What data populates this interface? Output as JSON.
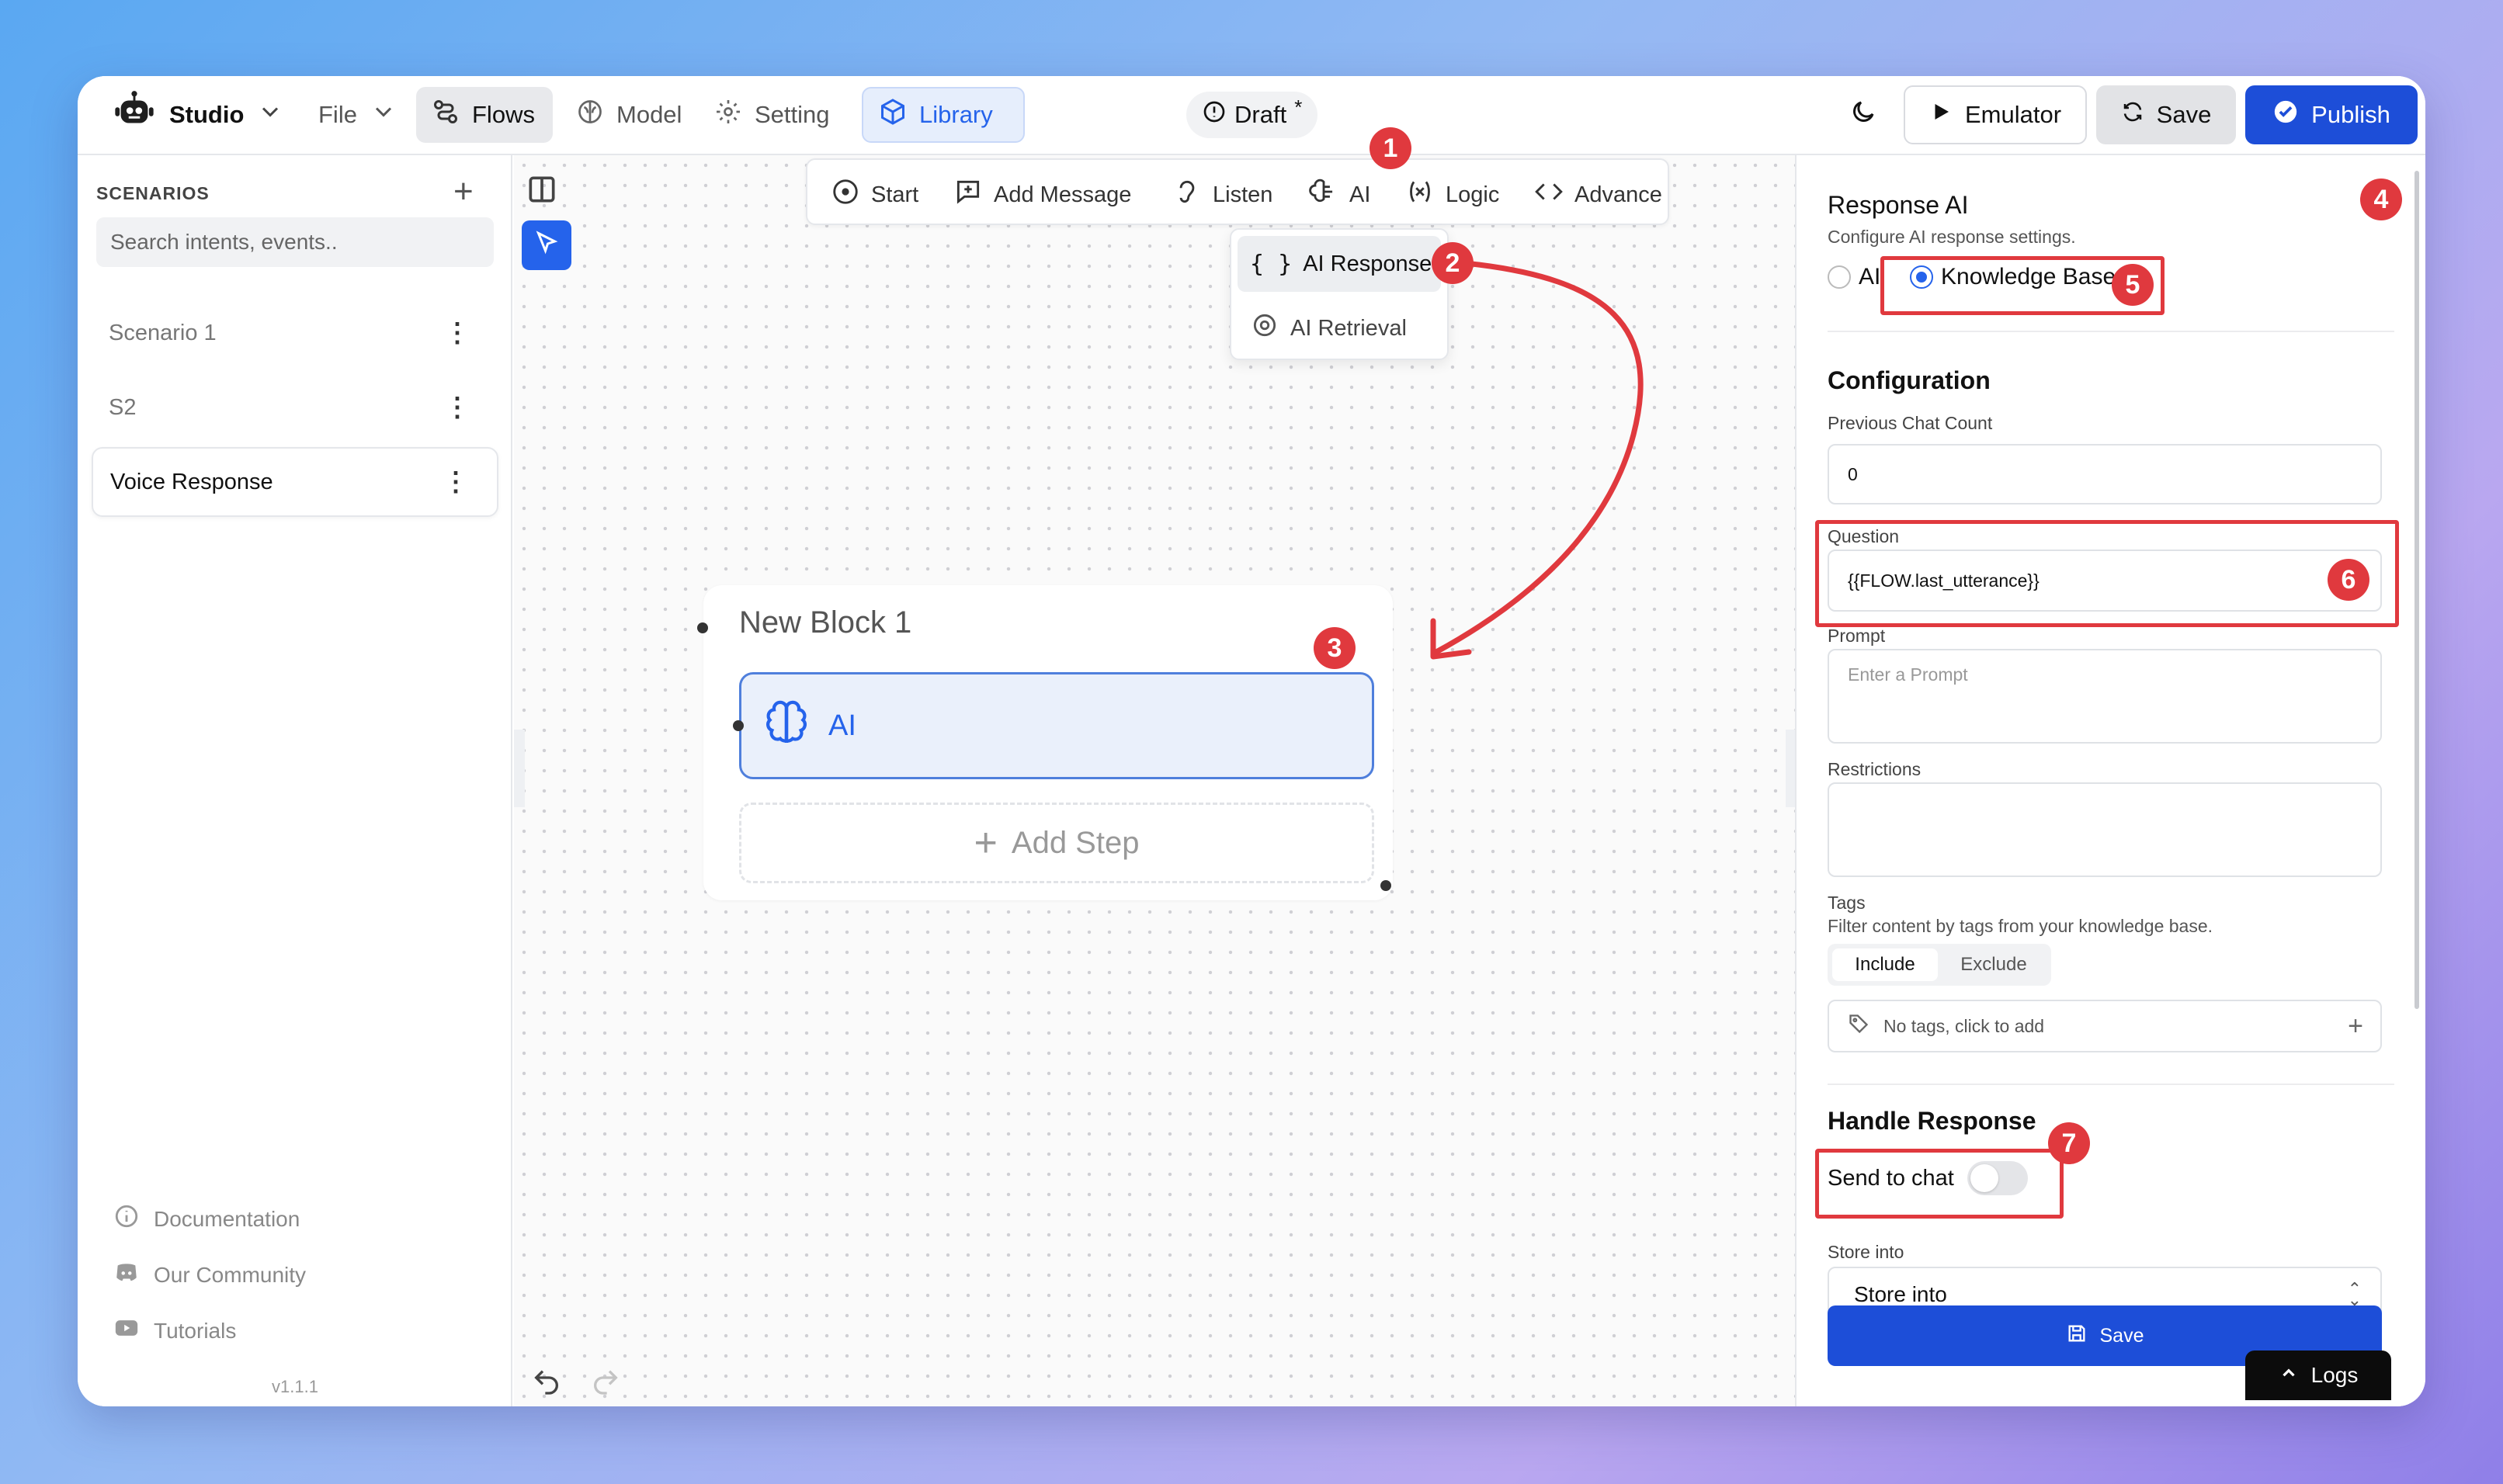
{
  "topbar": {
    "studio": "Studio",
    "file": "File",
    "flows": "Flows",
    "model": "Model",
    "setting": "Setting",
    "library": "Library",
    "draft": "Draft",
    "draft_mark": "*",
    "emulator": "Emulator",
    "save": "Save",
    "publish": "Publish"
  },
  "sidebar": {
    "heading": "SCENARIOS",
    "search_placeholder": "Search intents, events..",
    "scenarios": [
      {
        "label": "Scenario 1"
      },
      {
        "label": "S2"
      },
      {
        "label": "Voice Response"
      }
    ],
    "footer": {
      "documentation": "Documentation",
      "community": "Our Community",
      "tutorials": "Tutorials",
      "version": "v1.1.1"
    }
  },
  "toolbar": {
    "start": "Start",
    "add_message": "Add Message",
    "listen": "Listen",
    "ai": "AI",
    "logic": "Logic",
    "advance": "Advance"
  },
  "dropdown": {
    "ai_response": "AI Response",
    "ai_retrieval": "AI Retrieval"
  },
  "block": {
    "title": "New Block 1",
    "step_label": "AI",
    "add_step": "Add Step"
  },
  "panel": {
    "title": "Response AI",
    "subtitle": "Configure AI response settings.",
    "radio_ai": "AI",
    "radio_kb": "Knowledge Base",
    "config_heading": "Configuration",
    "prev_chat_label": "Previous Chat Count",
    "prev_chat_value": "0",
    "question_label": "Question",
    "question_value": "{{FLOW.last_utterance}}",
    "prompt_label": "Prompt",
    "prompt_placeholder": "Enter a Prompt",
    "restrictions_label": "Restrictions",
    "tags_label": "Tags",
    "tags_desc": "Filter content by tags from your knowledge base.",
    "include": "Include",
    "exclude": "Exclude",
    "no_tags": "No tags, click to add",
    "handle_heading": "Handle Response",
    "send_to_chat": "Send to chat",
    "send_to_chat_on": false,
    "store_label": "Store into",
    "store_value": "Store into",
    "save": "Save",
    "logs": "Logs"
  },
  "badges": [
    "1",
    "2",
    "3",
    "4",
    "5",
    "6",
    "7"
  ],
  "colors": {
    "primary": "#1d4ed8",
    "accent_library": "#2563eb",
    "annotation_red": "#e0393e",
    "step_bg": "#eaf0fb"
  }
}
